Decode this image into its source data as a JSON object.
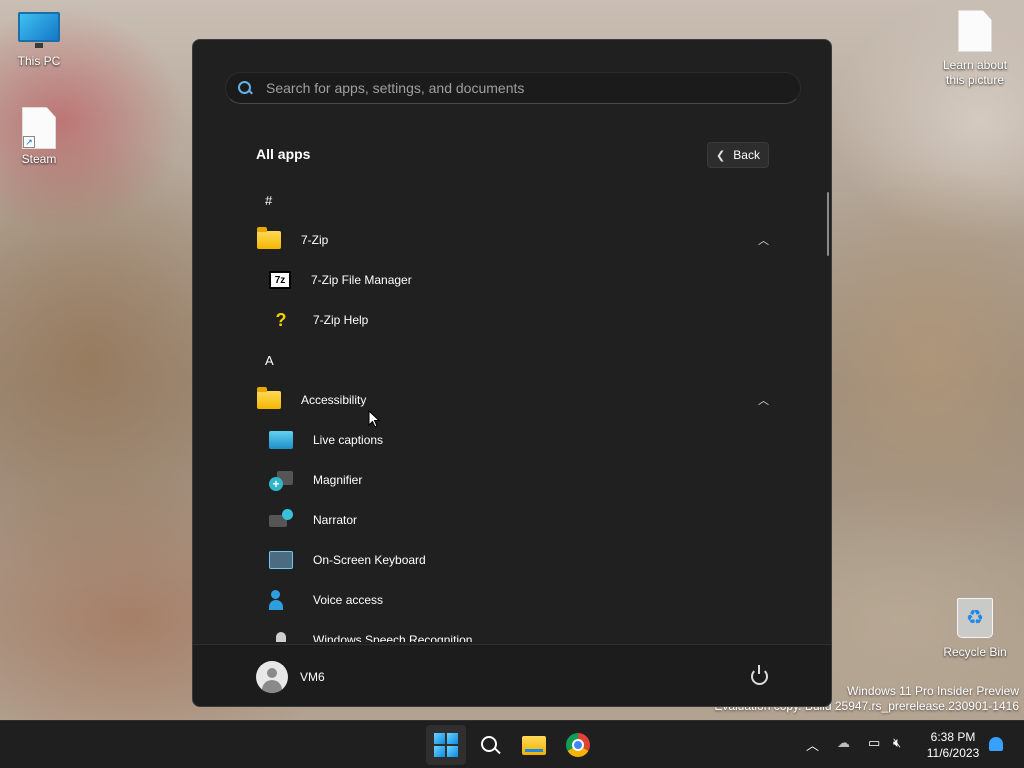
{
  "desktop": {
    "icons": {
      "this_pc": "This PC",
      "steam": "Steam",
      "learn_line1": "Learn about",
      "learn_line2": "this picture",
      "recycle_bin": "Recycle Bin"
    },
    "watermark_line1": "Windows 11 Pro Insider Preview",
    "watermark_line2": "Evaluation copy. Build 25947.rs_prerelease.230901-1416"
  },
  "start_menu": {
    "search_placeholder": "Search for apps, settings, and documents",
    "heading": "All apps",
    "back_label": "Back",
    "list": {
      "letter_hash": "#",
      "folder_7zip": "7-Zip",
      "app_7zip_fm": "7-Zip File Manager",
      "app_7zip_help": "7-Zip Help",
      "letter_a": "A",
      "folder_accessibility": "Accessibility",
      "app_live_captions": "Live captions",
      "app_magnifier": "Magnifier",
      "app_narrator": "Narrator",
      "app_osk": "On-Screen Keyboard",
      "app_voice_access": "Voice access",
      "app_speech": "Windows Speech Recognition"
    },
    "user_name": "VM6"
  },
  "taskbar": {
    "time": "6:38 PM",
    "date": "11/6/2023"
  },
  "colors": {
    "accent": "#0b8be0",
    "menu_bg": "#202020",
    "taskbar_bg": "#1f1f1f"
  }
}
